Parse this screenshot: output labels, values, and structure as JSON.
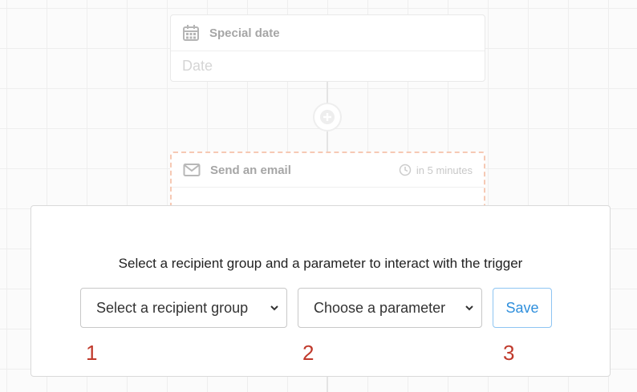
{
  "flow": {
    "trigger_card": {
      "title": "Special date",
      "field_placeholder": "Date",
      "icon": "calendar-icon"
    },
    "add_step_icon": "plus-icon",
    "email_card": {
      "title": "Send an email",
      "icon": "envelope-icon",
      "delay_icon": "clock-icon",
      "delay": "in 5 minutes"
    }
  },
  "panel": {
    "title": "Select a recipient group and a parameter to interact with the trigger",
    "recipient_select": {
      "selected": "Select a recipient group"
    },
    "parameter_select": {
      "selected": "Choose a parameter"
    },
    "save_label": "Save",
    "markers": [
      "1",
      "2",
      "3"
    ]
  },
  "colors": {
    "accent": "#2f8fdc",
    "marker": "#c0392b",
    "email_card_dashed_border": "#f6c9b4"
  }
}
